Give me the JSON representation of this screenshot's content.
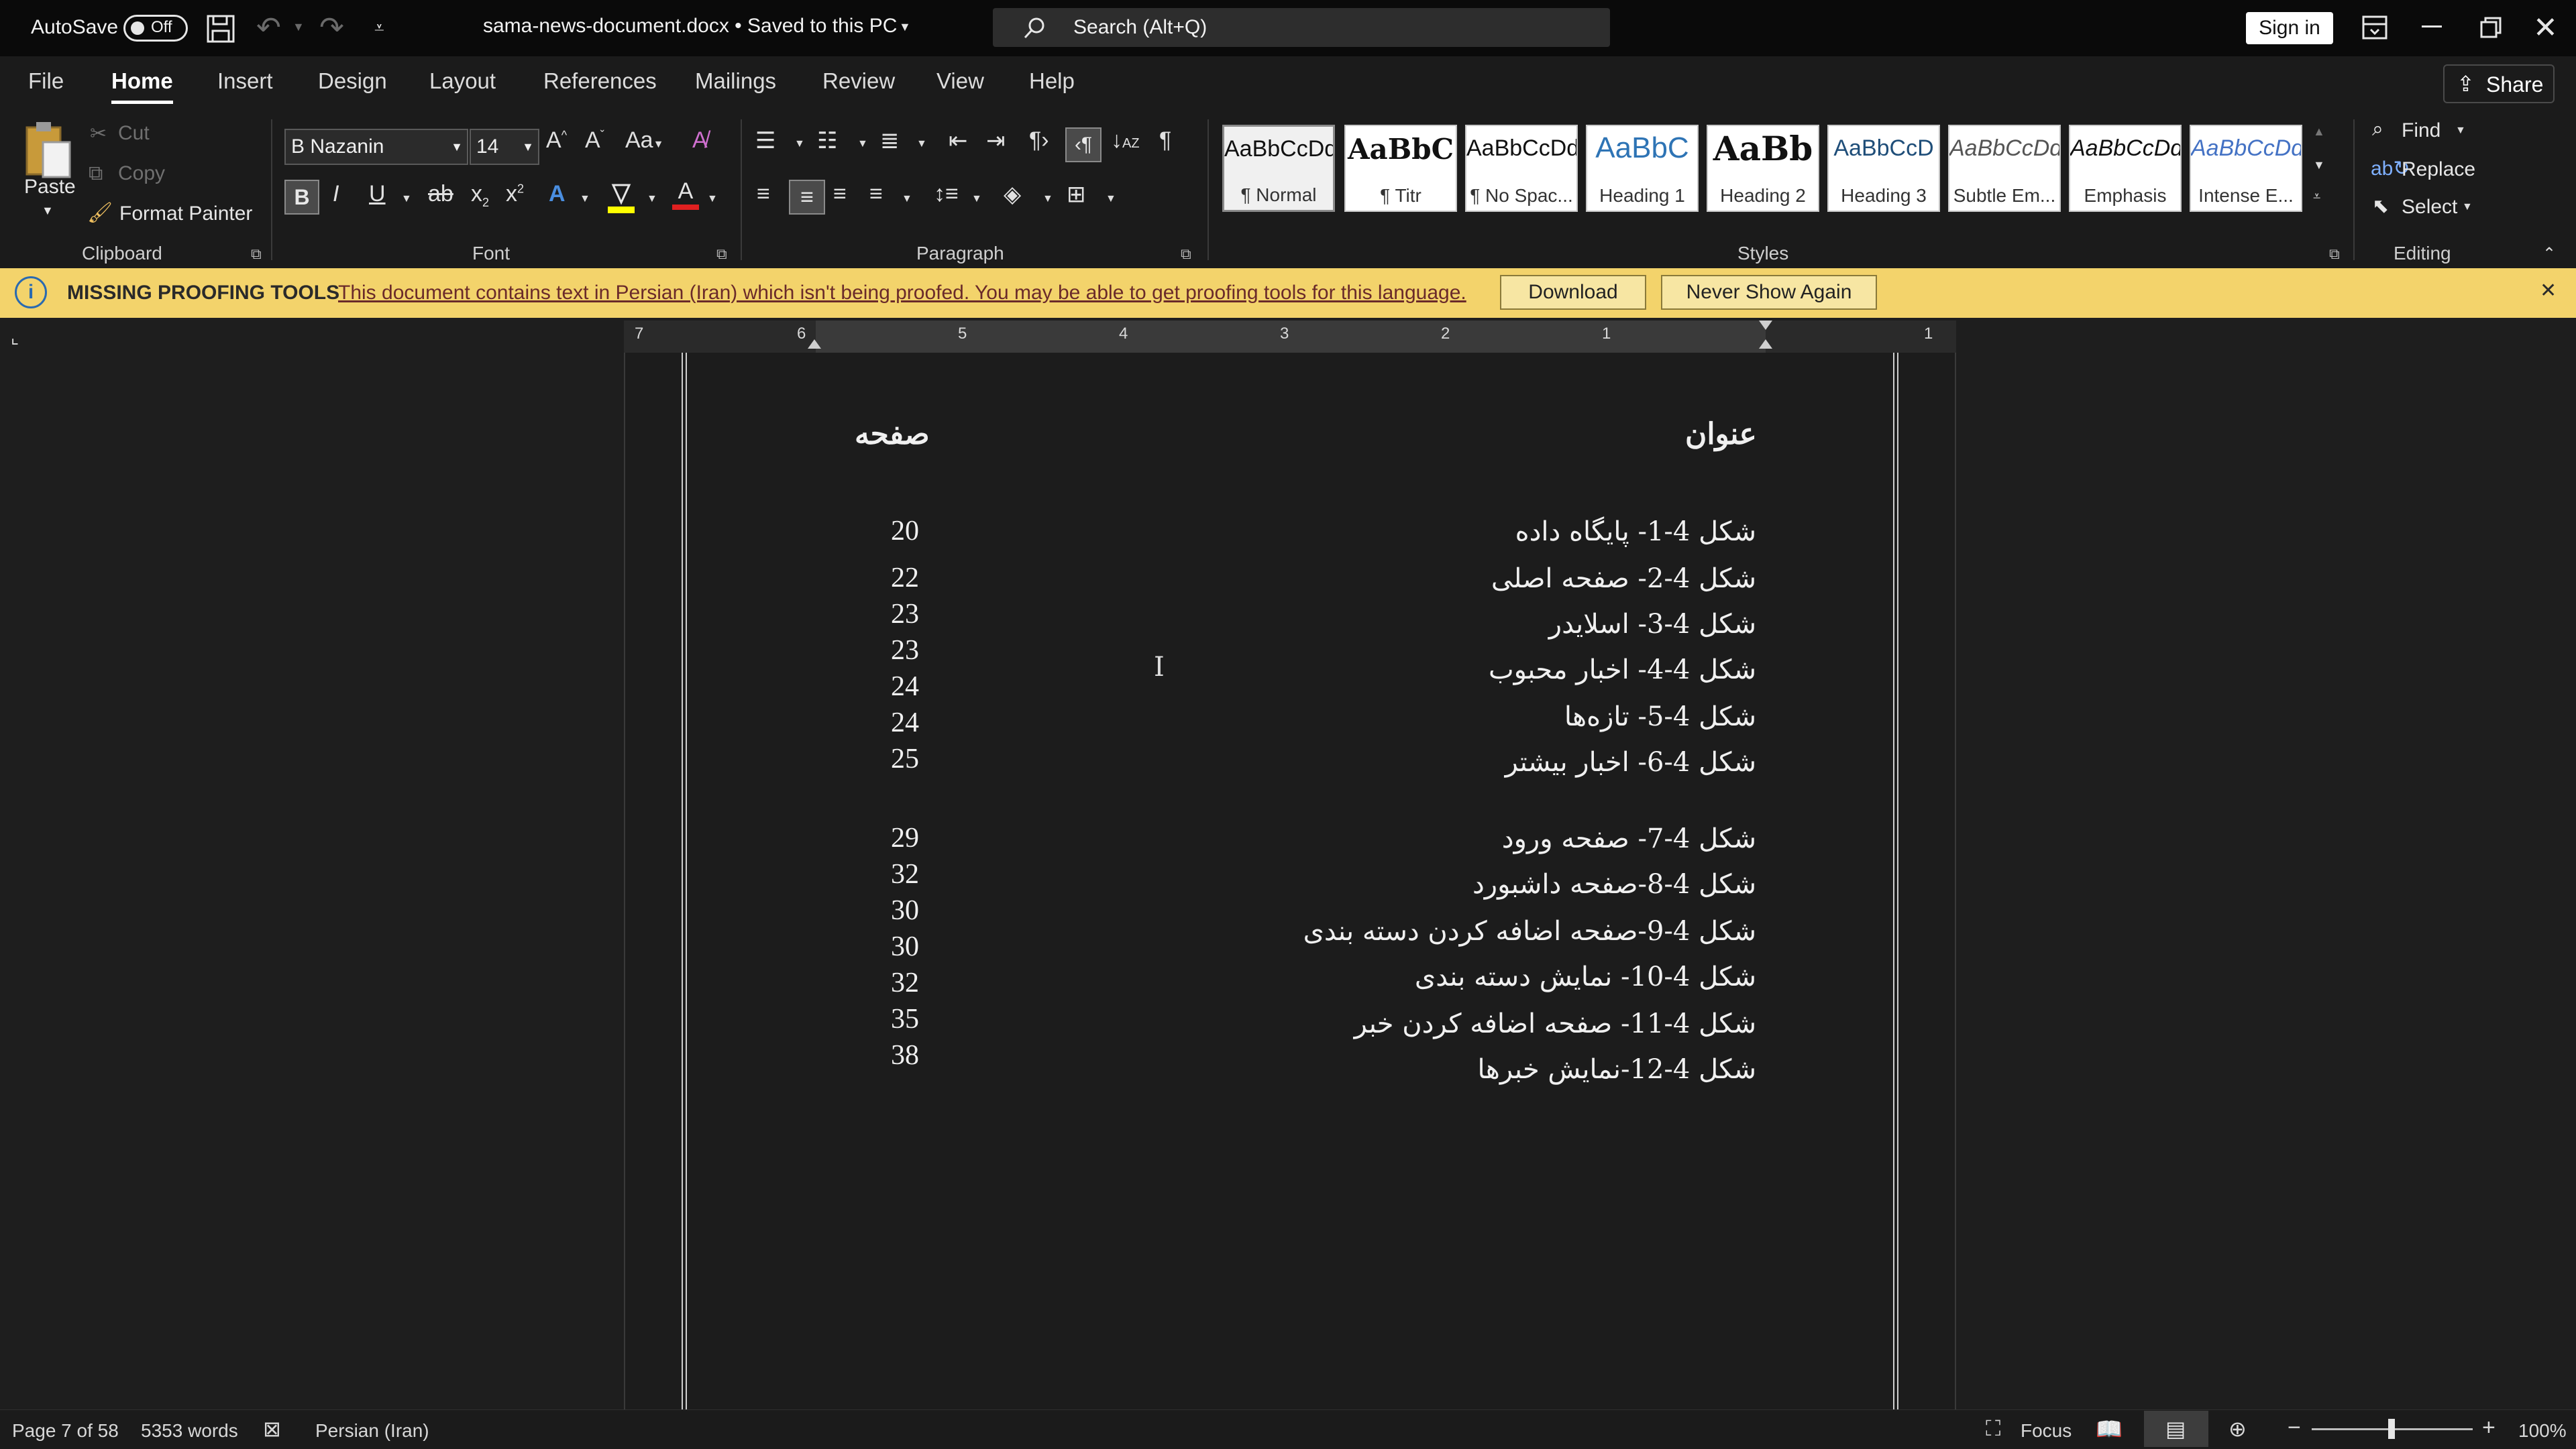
{
  "titlebar": {
    "autosave_label": "AutoSave",
    "autosave_state": "Off",
    "doc_title": "sama-news-document.docx • Saved to this PC",
    "search_placeholder": "Search (Alt+Q)",
    "signin": "Sign in"
  },
  "menu": {
    "tabs": [
      "File",
      "Home",
      "Insert",
      "Design",
      "Layout",
      "References",
      "Mailings",
      "Review",
      "View",
      "Help"
    ],
    "active": "Home",
    "share": "Share"
  },
  "ribbon": {
    "clipboard": {
      "paste": "Paste",
      "cut": "Cut",
      "copy": "Copy",
      "format_painter": "Format Painter",
      "label": "Clipboard"
    },
    "font": {
      "name": "B Nazanin",
      "size": "14",
      "label": "Font"
    },
    "paragraph": {
      "label": "Paragraph"
    },
    "styles": {
      "label": "Styles",
      "items": [
        {
          "sample": "AaBbCcDd",
          "name": "¶ Normal"
        },
        {
          "sample": "AaBbC",
          "name": "¶ Titr"
        },
        {
          "sample": "AaBbCcDd",
          "name": "¶ No Spac..."
        },
        {
          "sample": "AaBbC",
          "name": "Heading 1"
        },
        {
          "sample": "AaBb",
          "name": "Heading 2"
        },
        {
          "sample": "AaBbCcD",
          "name": "Heading 3"
        },
        {
          "sample": "AaBbCcDd",
          "name": "Subtle Em..."
        },
        {
          "sample": "AaBbCcDd",
          "name": "Emphasis"
        },
        {
          "sample": "AaBbCcDd",
          "name": "Intense E..."
        }
      ]
    },
    "editing": {
      "find": "Find",
      "replace": "Replace",
      "select": "Select",
      "label": "Editing"
    }
  },
  "infobar": {
    "title": "MISSING PROOFING TOOLS",
    "message": "This document contains text in Persian (Iran) which isn't being proofed. You may be able to get proofing tools for this language.",
    "download": "Download",
    "never_show": "Never Show Again"
  },
  "ruler": {
    "numbers": [
      "7",
      "6",
      "5",
      "4",
      "3",
      "2",
      "1",
      "1"
    ]
  },
  "document": {
    "header_title": "عنوان",
    "header_page": "صفحه",
    "entries": [
      {
        "title": "شکل 4-1- پایگاه داده",
        "page": "20"
      },
      {
        "title": "شکل 4-2- صفحه اصلی",
        "page": "22"
      },
      {
        "title": "شکل 4-3- اسلایدر",
        "page": "23"
      },
      {
        "title": "شکل 4-4- اخبار محبوب",
        "page": "23"
      },
      {
        "title": "شکل 4-5- تازه‌ها",
        "page": "24"
      },
      {
        "title": "شکل 4-6- اخبار بیشتر",
        "page": "24"
      },
      {
        "title": "شکل 4-7- صفحه ورود",
        "page": "25"
      },
      {
        "title": "شکل 4-8-صفحه داشبورد",
        "page": "29"
      },
      {
        "title": "شکل 4-9-صفحه اضافه کردن دسته بندی",
        "page": "32"
      },
      {
        "title": "شکل 4-10- نمایش دسته بندی",
        "page": "30"
      },
      {
        "title": "شکل 4-11- صفحه اضافه کردن خبر",
        "page": "30"
      },
      {
        "title": "شکل 4-12-نمایش خبرها",
        "page": "32"
      },
      {
        "title": "",
        "page": "35"
      },
      {
        "title": "",
        "page": "38"
      }
    ]
  },
  "statusbar": {
    "page": "Page 7 of 58",
    "words": "5353 words",
    "language": "Persian (Iran)",
    "focus": "Focus",
    "zoom": "100%"
  },
  "colors": {
    "infobar": "#f3d36b",
    "background": "#1e1e1e",
    "font_color_red": "#e02020",
    "highlight_yellow": "#ffff00"
  }
}
